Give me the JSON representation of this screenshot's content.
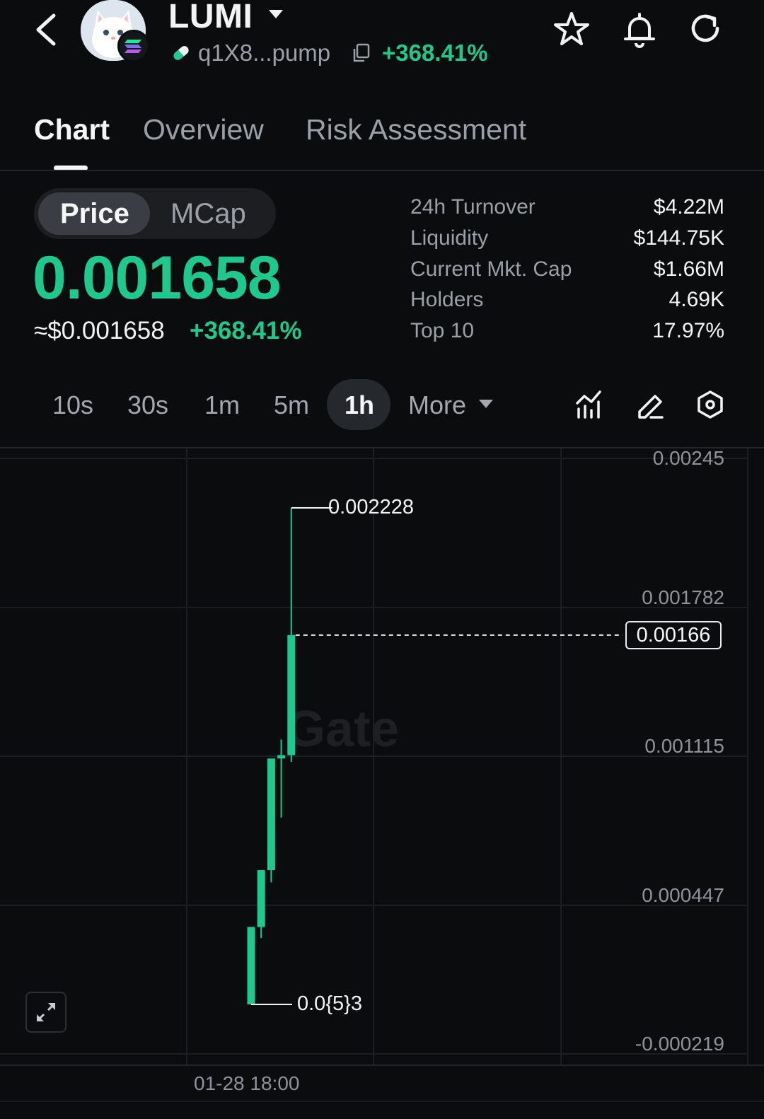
{
  "header": {
    "token_name": "LUMI",
    "address": "q1X8...pump",
    "change": "+368.41%"
  },
  "tabs": [
    {
      "label": "Chart",
      "active": true
    },
    {
      "label": "Overview",
      "active": false
    },
    {
      "label": "Risk Assessment",
      "active": false
    }
  ],
  "toggle": {
    "price_label": "Price",
    "mcap_label": "MCap",
    "selected": "Price"
  },
  "price": {
    "value": "0.001658",
    "usd": "≈$0.001658",
    "change": "+368.41%"
  },
  "stats": [
    {
      "label": "24h  Turnover",
      "value": "$4.22M"
    },
    {
      "label": "Liquidity",
      "value": "$144.75K"
    },
    {
      "label": "Current Mkt. Cap",
      "value": "$1.66M"
    },
    {
      "label": "Holders",
      "value": "4.69K"
    },
    {
      "label": "Top 10",
      "value": "17.97%"
    }
  ],
  "intervals": {
    "options": [
      "10s",
      "30s",
      "1m",
      "5m",
      "1h"
    ],
    "selected": "1h",
    "more_label": "More"
  },
  "chart_data": {
    "type": "candlestick",
    "y_ticks": [
      "0.00245",
      "0.001782",
      "0.001115",
      "0.000447",
      "-0.000219"
    ],
    "ylim": [
      -0.000219,
      0.00245
    ],
    "x_tick": "01-28 18:00",
    "current_price_tag": "0.00166",
    "high_label": "0.002228",
    "low_label": "0.0{5}3",
    "watermark": "Gate",
    "candles": [
      {
        "open": 3e-06,
        "high": 0.00035,
        "low": 3e-06,
        "close": 0.00035
      },
      {
        "open": 0.00035,
        "high": 0.000605,
        "low": 0.0003,
        "close": 0.000605
      },
      {
        "open": 0.000605,
        "high": 0.0011,
        "low": 0.00055,
        "close": 0.001105
      },
      {
        "open": 0.001105,
        "high": 0.00119,
        "low": 0.00084,
        "close": 0.00112
      },
      {
        "open": 0.00112,
        "high": 0.002228,
        "low": 0.00109,
        "close": 0.001658
      }
    ],
    "colors": {
      "up": "#1dc98c",
      "grid": "#1b1e22"
    }
  }
}
